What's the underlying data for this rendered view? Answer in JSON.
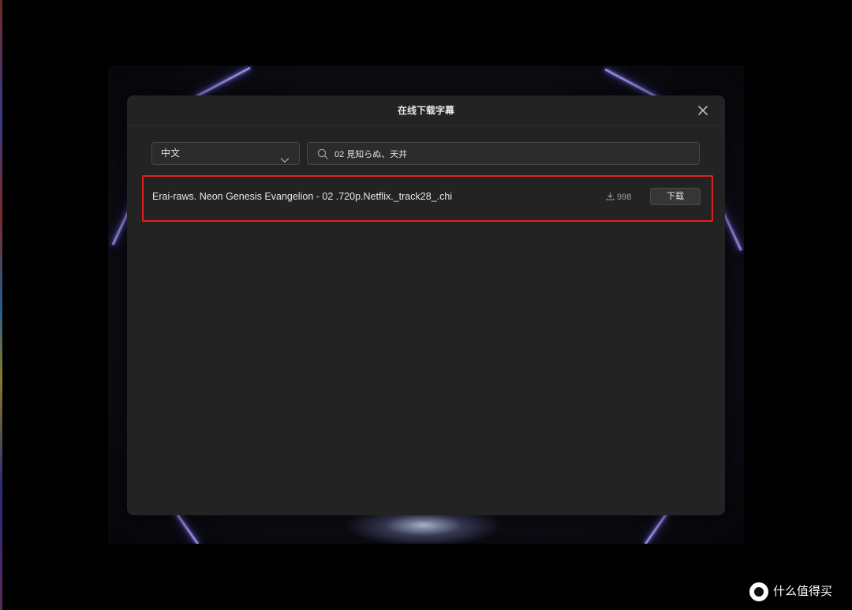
{
  "dialog": {
    "title": "在线下载字幕"
  },
  "filters": {
    "language_selected": "中文",
    "search_value": "02 見知らぬ、天井"
  },
  "results": [
    {
      "filename": "Erai-raws. Neon Genesis Evangelion - 02 .720p.Netflix._track28_.chi",
      "downloads": "998",
      "download_label": "下载"
    }
  ],
  "watermark": {
    "text": "什么值得买"
  },
  "colors": {
    "dialog_bg": "#232323",
    "highlight_border": "#e02020",
    "neon": "#8e86d8"
  },
  "icons": {
    "close": "close-icon",
    "chevron": "chevron-down-icon",
    "search": "search-icon",
    "download": "download-icon"
  }
}
